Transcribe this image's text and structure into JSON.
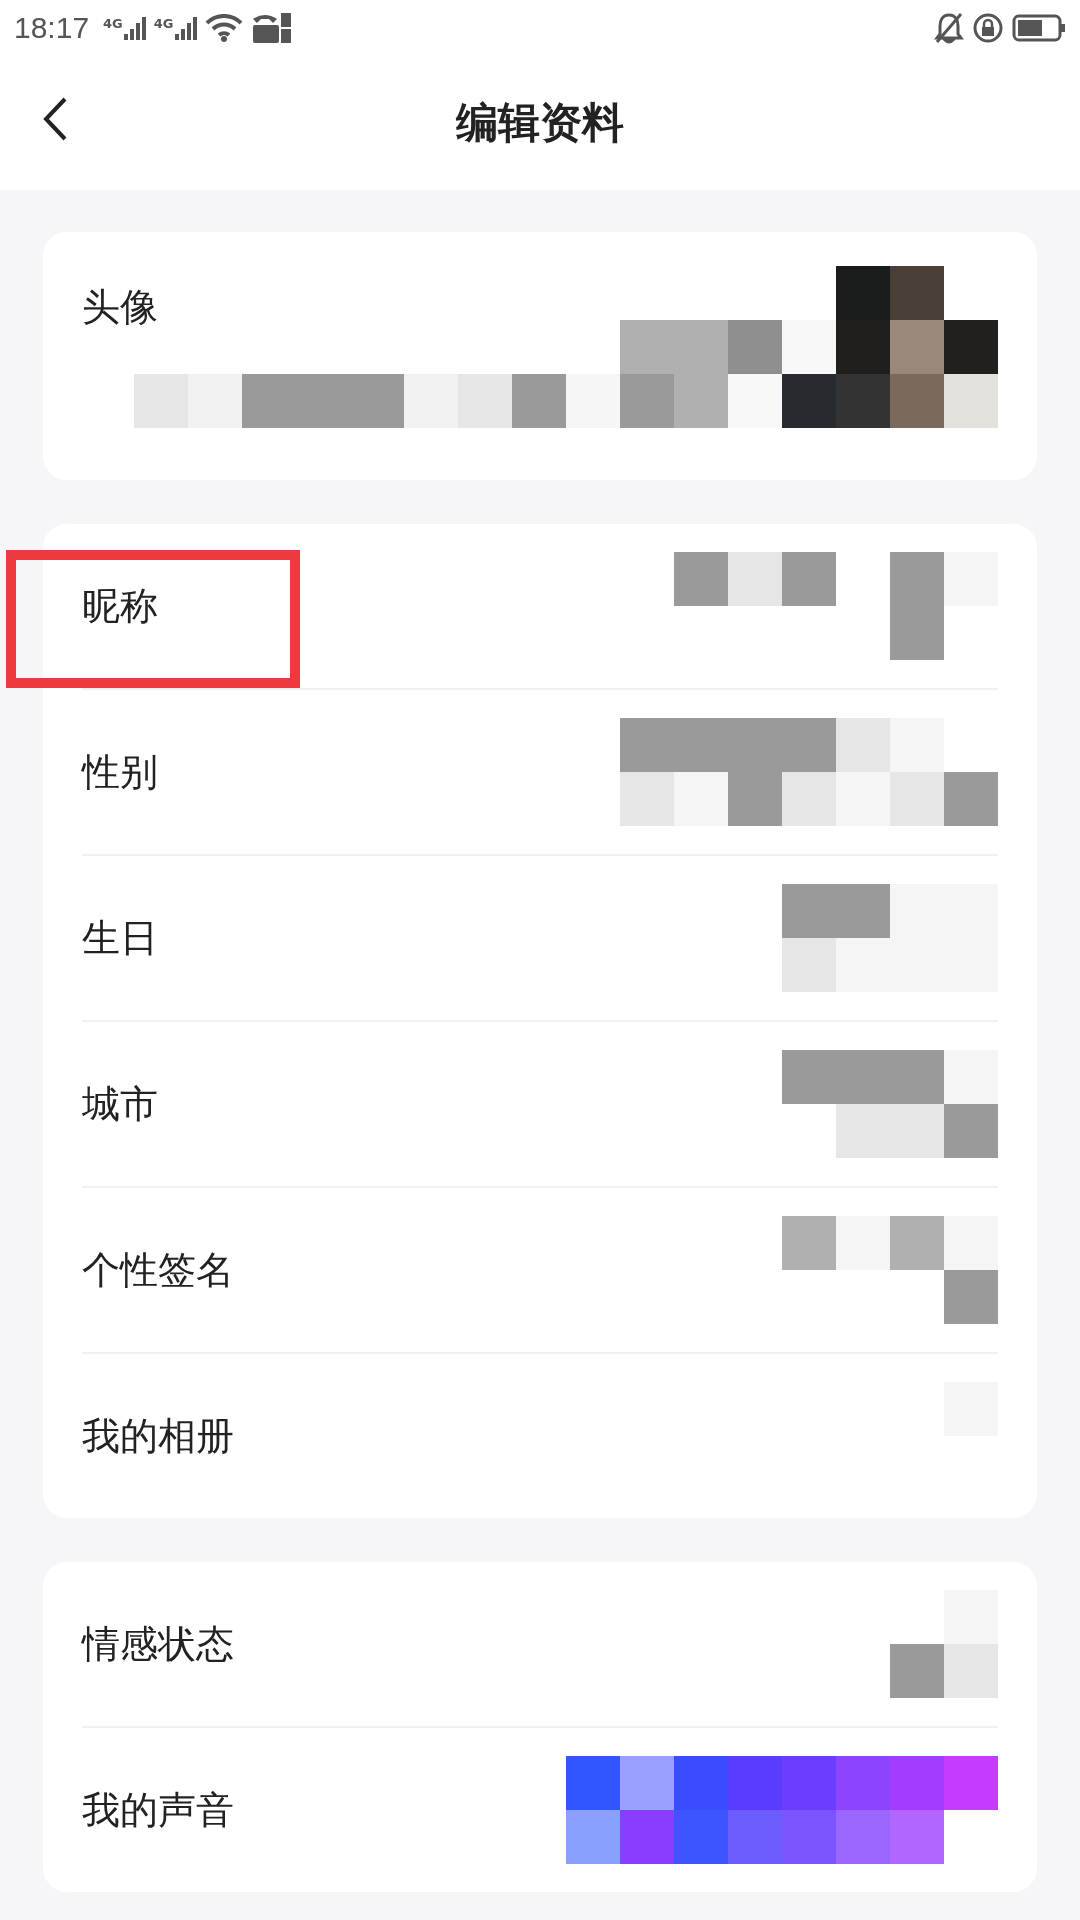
{
  "status_bar": {
    "time": "18:17",
    "signal_label_1": "4G",
    "signal_label_2": "4G"
  },
  "header": {
    "title": "编辑资料"
  },
  "sections": [
    {
      "rows": [
        {
          "label": "头像",
          "kind": "avatar",
          "highlighted": false
        }
      ]
    },
    {
      "rows": [
        {
          "label": "昵称",
          "kind": "text",
          "highlighted": true
        },
        {
          "label": "性别",
          "kind": "text",
          "highlighted": false
        },
        {
          "label": "生日",
          "kind": "text",
          "highlighted": false
        },
        {
          "label": "城市",
          "kind": "text",
          "highlighted": false
        },
        {
          "label": "个性签名",
          "kind": "text",
          "highlighted": false
        },
        {
          "label": "我的相册",
          "kind": "text",
          "highlighted": false
        }
      ]
    },
    {
      "rows": [
        {
          "label": "情感状态",
          "kind": "text",
          "highlighted": false
        },
        {
          "label": "我的声音",
          "kind": "voice",
          "highlighted": false
        }
      ]
    }
  ]
}
